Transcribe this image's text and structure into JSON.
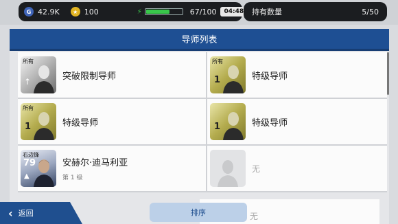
{
  "status": {
    "gp_icon_label": "G",
    "gp_value": "42.9K",
    "coin_icon_label": "★",
    "coin_value": "100",
    "energy_value": "67/100",
    "energy_fraction": 0.67,
    "timer": "04:48",
    "owned_label": "持有数量",
    "owned_value": "5/50"
  },
  "panel": {
    "title": "导师列表"
  },
  "cells": [
    {
      "name": "突破限制导师",
      "sub": "",
      "card": {
        "style": "silver",
        "tag": "所有",
        "mark": "↑"
      }
    },
    {
      "name": "特级导师",
      "sub": "",
      "card": {
        "style": "gold",
        "tag": "所有",
        "mark": "1"
      }
    },
    {
      "name": "特级导师",
      "sub": "",
      "card": {
        "style": "gold",
        "tag": "所有",
        "mark": "1"
      }
    },
    {
      "name": "特级导师",
      "sub": "",
      "card": {
        "style": "gold",
        "tag": "",
        "mark": "1"
      }
    },
    {
      "name": "安赫尔·迪马利亚",
      "sub": "第 1 级",
      "card": {
        "style": "blue",
        "tag": "右边锋",
        "rating": "79",
        "mark": "▲"
      }
    },
    {
      "name": "无",
      "sub": "",
      "card": {
        "style": "empty",
        "tag": "",
        "mark": ""
      }
    }
  ],
  "bottom": {
    "back_label": "返回",
    "sort_label": "排序",
    "peek_label": "无"
  },
  "icons": {
    "back": "chevron-left-icon",
    "energy": "bolt-icon"
  }
}
